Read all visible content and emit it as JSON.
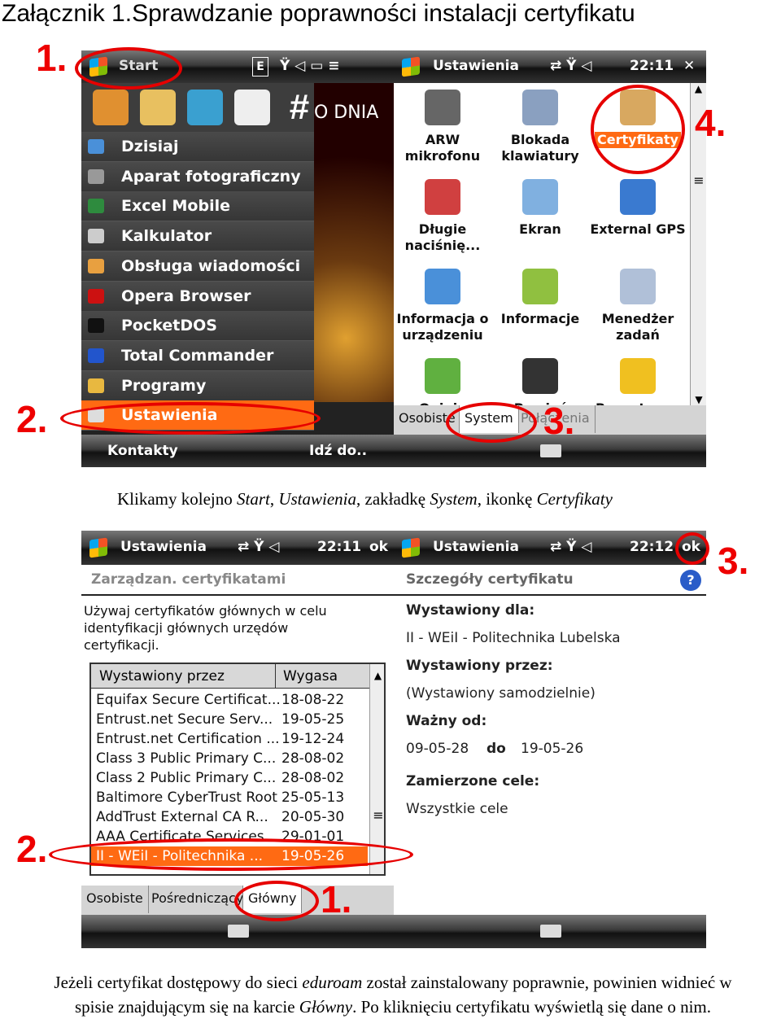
{
  "title": "Załącznik 1.Sprawdzanie poprawności instalacji certyfikatu",
  "screen1": {
    "start_label": "Start",
    "edge_label": "E",
    "menu_icons": [
      "camera-icon",
      "search-icon",
      "webcam-icon",
      "cards-icon",
      "hash-icon"
    ],
    "today_banner": "O DNIA",
    "menu_items": [
      {
        "label": "Dzisiaj",
        "color": "#4a90d9"
      },
      {
        "label": "Aparat fotograficzny",
        "color": "#999999"
      },
      {
        "label": "Excel Mobile",
        "color": "#2e8b3e"
      },
      {
        "label": "Kalkulator",
        "color": "#cccccc"
      },
      {
        "label": "Obsługa wiadomości",
        "color": "#e8a040"
      },
      {
        "label": "Opera Browser",
        "color": "#cc1111"
      },
      {
        "label": "PocketDOS",
        "color": "#111111"
      },
      {
        "label": "Total Commander",
        "color": "#2255cc"
      },
      {
        "label": "Programy",
        "color": "#e8b840"
      },
      {
        "label": "Ustawienia",
        "color": "#dddddd"
      }
    ],
    "softkeys": {
      "left": "Kontakty",
      "right": "Idź do.."
    },
    "settings_title": "Ustawienia",
    "time": "22:11",
    "close": "✕",
    "settings_items": [
      {
        "label": "ARW\nmikrofonu",
        "color": "#666666"
      },
      {
        "label": "Blokada\nklawiatury",
        "color": "#8aa0c0"
      },
      {
        "label": "Certyfikaty",
        "color": "#d8a860"
      },
      {
        "label": "Długie\nnaciśnię...",
        "color": "#d04040"
      },
      {
        "label": "Ekran",
        "color": "#80b0e0"
      },
      {
        "label": "External GPS",
        "color": "#3a7ad0"
      },
      {
        "label": "Informacja o\nurządzeniu",
        "color": "#4a90d9"
      },
      {
        "label": "Informacje",
        "color": "#90c040"
      },
      {
        "label": "Menedżer\nzadań",
        "color": "#b0c0d8"
      },
      {
        "label": "Opinie",
        "color": "#60b040"
      },
      {
        "label": "Pamięć",
        "color": "#333333"
      },
      {
        "label": "Raportow...",
        "color": "#f0c020"
      }
    ],
    "tabs": [
      "Osobiste",
      "System",
      "Połączenia"
    ],
    "active_tab": "System"
  },
  "caption1": {
    "parts": [
      "Klikamy kolejno ",
      "Start",
      ", ",
      "Ustawienia",
      ", zakładkę ",
      "System",
      ", ikonkę ",
      "Certyfikaty"
    ]
  },
  "screen2": {
    "left": {
      "title": "Ustawienia",
      "time": "22:11",
      "ok": "ok",
      "heading": "Zarządzan. certyfikatami",
      "description": "Używaj certyfikatów głównych w celu identyfikacji głównych urzędów certyfikacji.",
      "columns": [
        "Wystawiony przez",
        "Wygasa"
      ],
      "rows": [
        [
          "Equifax Secure Certificat...",
          "18-08-22"
        ],
        [
          "Entrust.net Secure Serv...",
          "19-05-25"
        ],
        [
          "Entrust.net Certification ...",
          "19-12-24"
        ],
        [
          "Class 3 Public Primary C...",
          "28-08-02"
        ],
        [
          "Class 2 Public Primary C...",
          "28-08-02"
        ],
        [
          "Baltimore CyberTrust Root",
          "25-05-13"
        ],
        [
          "AddTrust External CA R...",
          "20-05-30"
        ],
        [
          "AAA Certificate Services",
          "29-01-01"
        ],
        [
          "II - WEiI - Politechnika ...",
          "19-05-26"
        ]
      ],
      "tabs": [
        "Osobiste",
        "Pośredniczący",
        "Główny"
      ],
      "active_tab": "Główny"
    },
    "right": {
      "title": "Ustawienia",
      "time": "22:12",
      "ok": "ok",
      "heading": "Szczegóły certyfikatu",
      "issued_to_label": "Wystawiony dla:",
      "issued_to": "II - WEiI - Politechnika Lubelska",
      "issued_by_label": "Wystawiony przez:",
      "issued_by": "(Wystawiony samodzielnie)",
      "valid_label": "Ważny od:",
      "valid_from": "09-05-28",
      "to_label": "do",
      "valid_to": "19-05-26",
      "purposes_label": "Zamierzone cele:",
      "purposes": "Wszystkie cele"
    }
  },
  "annotations": {
    "n1": "1.",
    "n2": "2.",
    "n3": "3.",
    "n4": "4.",
    "color": "#e60000"
  },
  "caption2": {
    "parts": [
      "Jeżeli certyfikat dostępowy do sieci ",
      "eduroam",
      " został zainstalowany poprawnie, powinien widnieć w"
    ],
    "line2": [
      "spisie znajdującym się na karcie ",
      "Główny",
      ". Po kliknięciu certyfikatu wyświetlą się dane o nim."
    ]
  }
}
